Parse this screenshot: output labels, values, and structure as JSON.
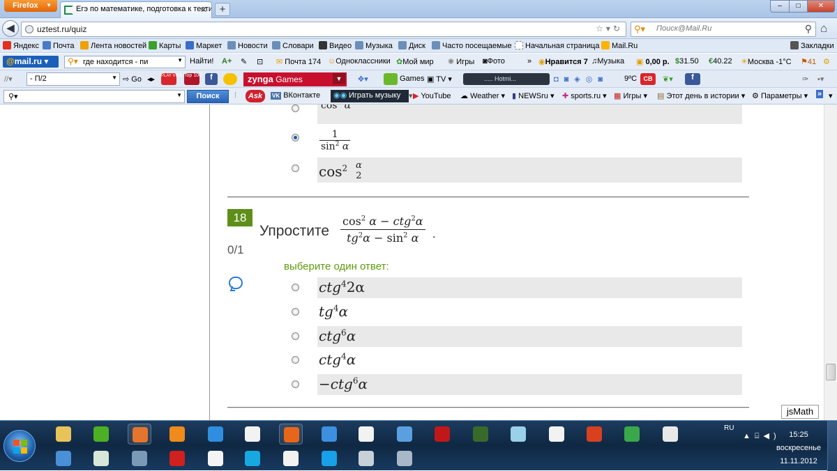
{
  "window": {
    "firefox_button": "Firefox",
    "tab_title": "Егэ по математике, подготовка к тести...",
    "new_tab": "+",
    "controls": {
      "minimize": "–",
      "maximize": "□",
      "close": "✕"
    }
  },
  "navbar": {
    "url": "uztest.ru/quiz",
    "search_placeholder": "Поиск@Mail.Ru"
  },
  "bookmarks": [
    {
      "label": "Яндекс",
      "icon": "yandex-icon",
      "color": "#e0301e"
    },
    {
      "label": "Почта",
      "icon": "mail-icon",
      "color": "#4a7ac8"
    },
    {
      "label": "Лента новостей",
      "icon": "rss-icon",
      "color": "#f0a000"
    },
    {
      "label": "Карты",
      "icon": "maps-icon",
      "color": "#3aa12c"
    },
    {
      "label": "Маркет",
      "icon": "market-icon",
      "color": "#3a6ec8"
    },
    {
      "label": "Новости",
      "icon": "news-icon",
      "color": "#6b8fb8"
    },
    {
      "label": "Словари",
      "icon": "dictionary-icon",
      "color": "#6b8fb8"
    },
    {
      "label": "Видео",
      "icon": "video-icon",
      "color": "#333333"
    },
    {
      "label": "Музыка",
      "icon": "music-icon",
      "color": "#6b8fb8"
    },
    {
      "label": "Диск",
      "icon": "disk-icon",
      "color": "#6b8fb8"
    },
    {
      "label": "Часто посещаемые",
      "icon": "frequent-icon",
      "color": "#6b8fb8"
    },
    {
      "label": "Начальная страница",
      "icon": "page-icon",
      "color": "#ffffff"
    },
    {
      "label": "Mail.Ru",
      "icon": "mailru-icon",
      "color": "#ffb400"
    },
    {
      "label": "Закладки",
      "icon": "bookmarks-icon",
      "color": "#555555"
    }
  ],
  "mailru_toolbar": {
    "logo_at": "@",
    "logo_text": "mail.ru",
    "search_value": "где находится - пи",
    "find": "Найти!",
    "mail": "Почта 174",
    "odnoklassniki": "Одноклассники",
    "myworld": "Мой мир",
    "games": "Игры",
    "photo": "Фото",
    "likes": "Нравится 7",
    "music": "Музыка",
    "money": "0,00 р.",
    "usd": "31.50",
    "eur": "40.22",
    "weather_city": "Москва -1°C",
    "notifications": "41"
  },
  "toolbar3": {
    "select_value": "- П/2",
    "go": "Go",
    "zynga_brand": "zynga",
    "zynga_label": "Games",
    "games": "Games",
    "tv": "TV",
    "player": "..... Hotmi...",
    "temp": "9ºC",
    "top100": "Top 100",
    "playvids": "PLAY VIDS",
    "cb": "CB"
  },
  "toolbar4": {
    "search_value": "",
    "search_button": "Поиск",
    "ask_logo": "Ask",
    "vk": "ВКонтакте",
    "play_music": "Играть музыку",
    "youtube": "YouTube",
    "weather": "Weather",
    "newsru": "NEWSru",
    "sports": "sports.ru",
    "games": "Игры",
    "history": "Этот день в истории",
    "params": "Параметры"
  },
  "quiz": {
    "prev_options": [
      {
        "type": "frac",
        "num": "",
        "den_fn": "cos",
        "den_exp": "2",
        "den_var": "α",
        "selected": false
      },
      {
        "type": "frac",
        "num": "1",
        "den_fn": "sin",
        "den_exp": "2",
        "den_var": "α",
        "selected": true
      },
      {
        "type": "inline",
        "fn": "cos",
        "exp": "2",
        "frac_num": "α",
        "frac_den": "2",
        "selected": false
      }
    ],
    "question": {
      "number": "18",
      "score": "0/1",
      "text": "Упростите",
      "num_a_fn": "cos",
      "num_a_exp": "2",
      "num_a_var": "α",
      "minus": " − ",
      "num_b_fn": "ctg",
      "num_b_exp": "2",
      "num_b_var": "α",
      "den_a_fn": "tg",
      "den_a_exp": "2",
      "den_a_var": "α",
      "den_b_fn": "sin",
      "den_b_exp": "2",
      "den_b_var": "α",
      "period": ".",
      "prompt": "выберите один ответ:"
    },
    "options": [
      {
        "sign": "",
        "fn": "ctg",
        "exp": "4",
        "arg": "2α",
        "selected": false
      },
      {
        "sign": "",
        "fn": "tg",
        "exp": "4",
        "arg": "α",
        "selected": false
      },
      {
        "sign": "",
        "fn": "ctg",
        "exp": "6",
        "arg": "α",
        "selected": false
      },
      {
        "sign": "",
        "fn": "ctg",
        "exp": "4",
        "arg": "α",
        "selected": false
      },
      {
        "sign": "−",
        "fn": "ctg",
        "exp": "6",
        "arg": "α",
        "selected": false
      }
    ],
    "jsmath": "jsMath"
  },
  "taskbar": {
    "lang": "RU",
    "time": "15:25",
    "day": "воскресенье",
    "date": "11.11.2012",
    "apps": [
      {
        "name": "explorer-app",
        "color": "#e8c35a"
      },
      {
        "name": "utorrent-app",
        "color": "#4caf24"
      },
      {
        "name": "paint-app",
        "color": "#e5742c"
      },
      {
        "name": "media-player-app",
        "color": "#f08a1a"
      },
      {
        "name": "ie-app",
        "color": "#2f8ee0"
      },
      {
        "name": "document-app",
        "color": "#f2f2f2"
      },
      {
        "name": "firefox-app",
        "color": "#e8661a"
      },
      {
        "name": "itunes-app",
        "color": "#3d8fe0"
      },
      {
        "name": "document2-app",
        "color": "#f2f2f2"
      },
      {
        "name": "remote-app",
        "color": "#5aa0e0"
      },
      {
        "name": "nfs-app",
        "color": "#c01818"
      },
      {
        "name": "angrybirds-app",
        "color": "#3a6a2a"
      },
      {
        "name": "notes-app",
        "color": "#9ad0e8"
      },
      {
        "name": "document3-app",
        "color": "#f2f2f2"
      },
      {
        "name": "ccleaner-app",
        "color": "#d84020"
      },
      {
        "name": "chrome-app",
        "color": "#3aa84a"
      },
      {
        "name": "yandex-app",
        "color": "#e8e8e8"
      },
      {
        "name": "mail-app",
        "color": "#4a90d8"
      },
      {
        "name": "terminal-app",
        "color": "#d8e8d8"
      },
      {
        "name": "winamp-app",
        "color": "#7a9ab8"
      },
      {
        "name": "twelve-app",
        "color": "#d02020"
      },
      {
        "name": "blank-app",
        "color": "#f4f4f4"
      },
      {
        "name": "qip-app",
        "color": "#18a8e0"
      },
      {
        "name": "document4-app",
        "color": "#f2f2f2"
      },
      {
        "name": "skype-app",
        "color": "#18a0e8"
      },
      {
        "name": "steam-app",
        "color": "#c8d0d8"
      },
      {
        "name": "calculator-app",
        "color": "#a8b8c8"
      }
    ]
  }
}
